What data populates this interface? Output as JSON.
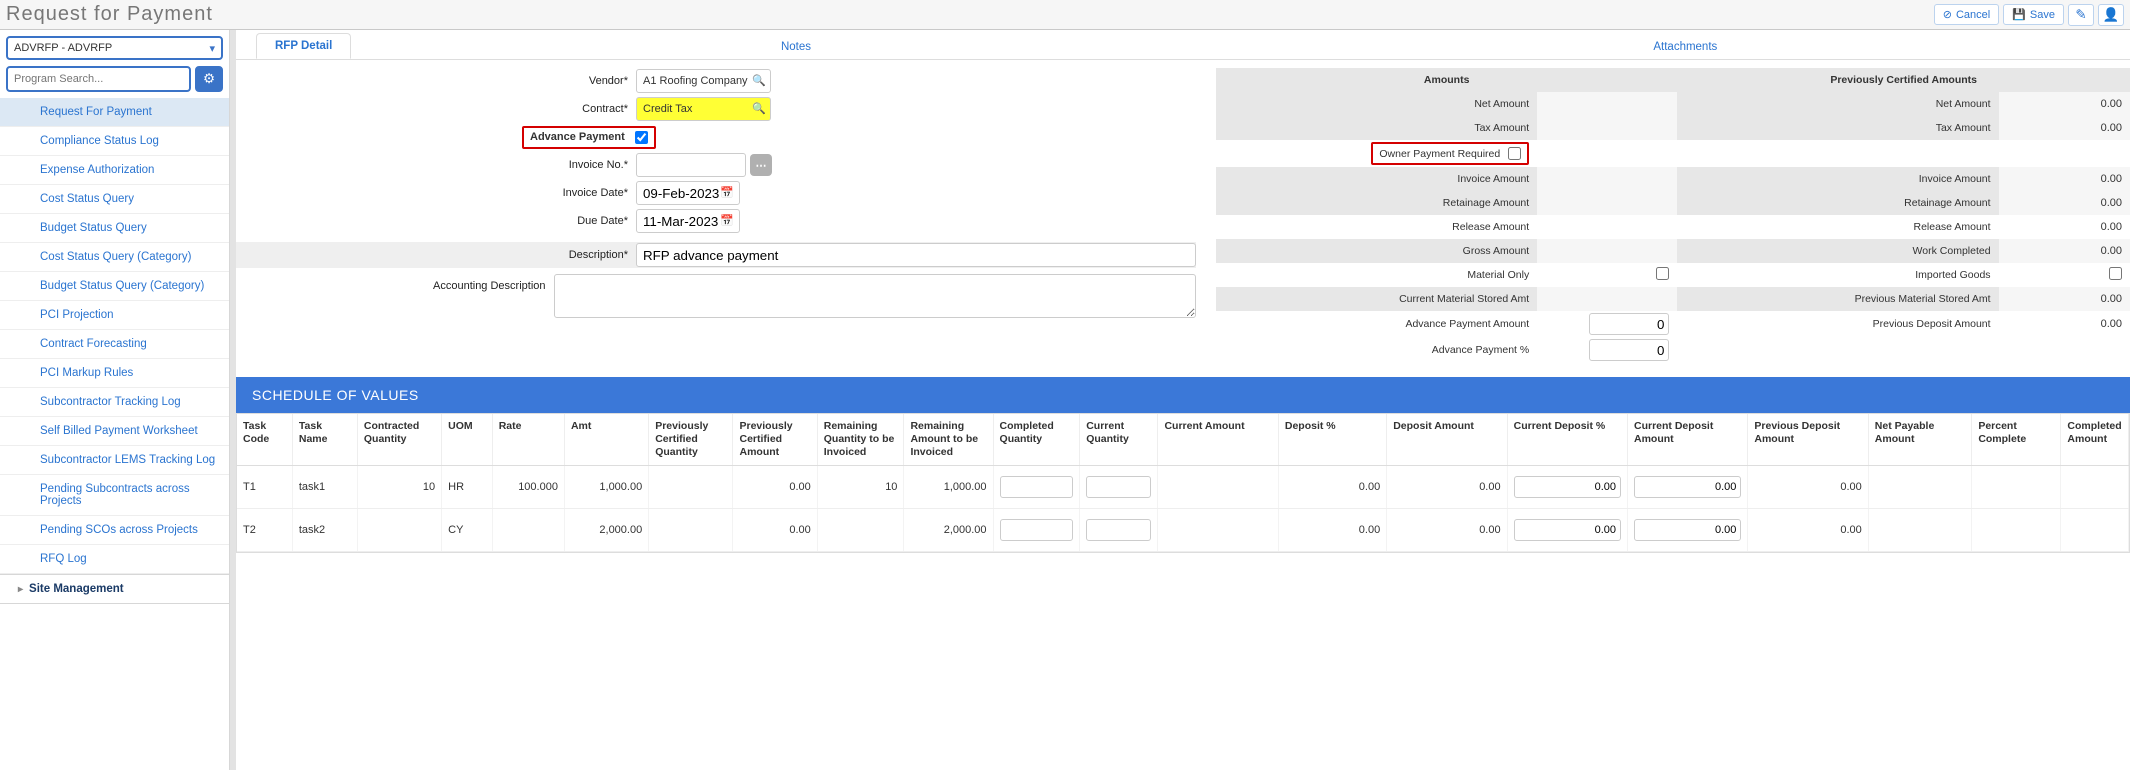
{
  "title": "Request for Payment",
  "actions": {
    "cancel": "Cancel",
    "save": "Save"
  },
  "sidebar": {
    "program_selected": "ADVRFP - ADVRFP",
    "search_placeholder": "Program Search...",
    "items": [
      "Request For Payment",
      "Compliance Status Log",
      "Expense Authorization",
      "Cost Status Query",
      "Budget Status Query",
      "Cost Status Query (Category)",
      "Budget Status Query (Category)",
      "PCI Projection",
      "Contract Forecasting",
      "PCI Markup Rules",
      "Subcontractor Tracking Log",
      "Self Billed Payment Worksheet",
      "Subcontractor LEMS Tracking Log",
      "Pending Subcontracts across Projects",
      "Pending SCOs across Projects",
      "RFQ Log"
    ],
    "groups": [
      "Site Management"
    ]
  },
  "tabs": [
    "RFP Detail",
    "Notes",
    "Attachments"
  ],
  "form": {
    "vendor_label": "Vendor*",
    "vendor": "A1 Roofing Company",
    "contract_label": "Contract*",
    "contract": "Credit Tax",
    "advance_label": "Advance Payment",
    "advance_checked": true,
    "invoice_no_label": "Invoice No.*",
    "invoice_no": "",
    "invoice_date_label": "Invoice Date*",
    "invoice_date": "09-Feb-2023",
    "due_date_label": "Due Date*",
    "due_date": "11-Mar-2023",
    "description_label": "Description*",
    "description": "RFP advance payment",
    "accounting_label": "Accounting Description",
    "accounting": ""
  },
  "amounts": {
    "hdr1": "Amounts",
    "hdr2": "Previously Certified Amounts",
    "rows": [
      {
        "l1": "Net Amount",
        "v1": "",
        "l2": "Net Amount",
        "v2": "0.00",
        "shade": true
      },
      {
        "l1": "Tax Amount",
        "v1": "",
        "l2": "Tax Amount",
        "v2": "0.00",
        "shade": true
      },
      {
        "owner_row": true,
        "l1": "Owner Payment Required",
        "l2": "",
        "v2": ""
      },
      {
        "l1": "Invoice Amount",
        "v1": "",
        "l2": "Invoice Amount",
        "v2": "0.00",
        "shade": true
      },
      {
        "l1": "Retainage Amount",
        "v1": "",
        "l2": "Retainage Amount",
        "v2": "0.00",
        "shade": true
      },
      {
        "l1": "Release Amount",
        "v1": "",
        "l2": "Release Amount",
        "v2": "0.00"
      },
      {
        "l1": "Gross Amount",
        "v1": "",
        "l2": "Work Completed",
        "v2": "0.00",
        "shade": true
      },
      {
        "l1": "Material Only",
        "chk": true,
        "l2": "Imported Goods",
        "chk2": true
      },
      {
        "l1": "Current Material Stored Amt",
        "v1": "",
        "l2": "Previous Material Stored Amt",
        "v2": "0.00",
        "shade": true
      },
      {
        "l1": "Advance Payment Amount",
        "input": true,
        "iv": "0",
        "l2": "Previous Deposit Amount",
        "v2": "0.00"
      },
      {
        "l1": "Advance Payment %",
        "input": true,
        "iv": "0",
        "l2": "",
        "v2": ""
      }
    ]
  },
  "sov": {
    "title": "SCHEDULE OF VALUES",
    "cols": [
      "Task Code",
      "Task Name",
      "Contracted Quantity",
      "UOM",
      "Rate",
      "Amt",
      "Previously Certified Quantity",
      "Previously Certified Amount",
      "Remaining Quantity to be Invoiced",
      "Remaining Amount to be Invoiced",
      "Completed Quantity",
      "Current Quantity",
      "Current Amount",
      "Deposit %",
      "Deposit Amount",
      "Current Deposit %",
      "Current Deposit Amount",
      "Previous Deposit Amount",
      "Net Payable Amount",
      "Percent Complete",
      "Completed Amount"
    ],
    "rows": [
      {
        "code": "T1",
        "name": "task1",
        "cq": "10",
        "uom": "HR",
        "rate": "100.000",
        "amt": "1,000.00",
        "pcq": "",
        "pca": "0.00",
        "rqi": "10",
        "rai": "1,000.00",
        "compq": "",
        "curq": "",
        "curamt": "",
        "depp": "0.00",
        "depa": "0.00",
        "cdp": "0.00",
        "cda": "0.00",
        "pda": "0.00",
        "npa": "",
        "pc": "",
        "ca": ""
      },
      {
        "code": "T2",
        "name": "task2",
        "cq": "",
        "uom": "CY",
        "rate": "",
        "amt": "2,000.00",
        "pcq": "",
        "pca": "0.00",
        "rqi": "",
        "rai": "2,000.00",
        "compq": "",
        "curq": "",
        "curamt": "",
        "depp": "0.00",
        "depa": "0.00",
        "cdp": "0.00",
        "cda": "0.00",
        "pda": "0.00",
        "npa": "",
        "pc": "",
        "ca": ""
      }
    ]
  }
}
